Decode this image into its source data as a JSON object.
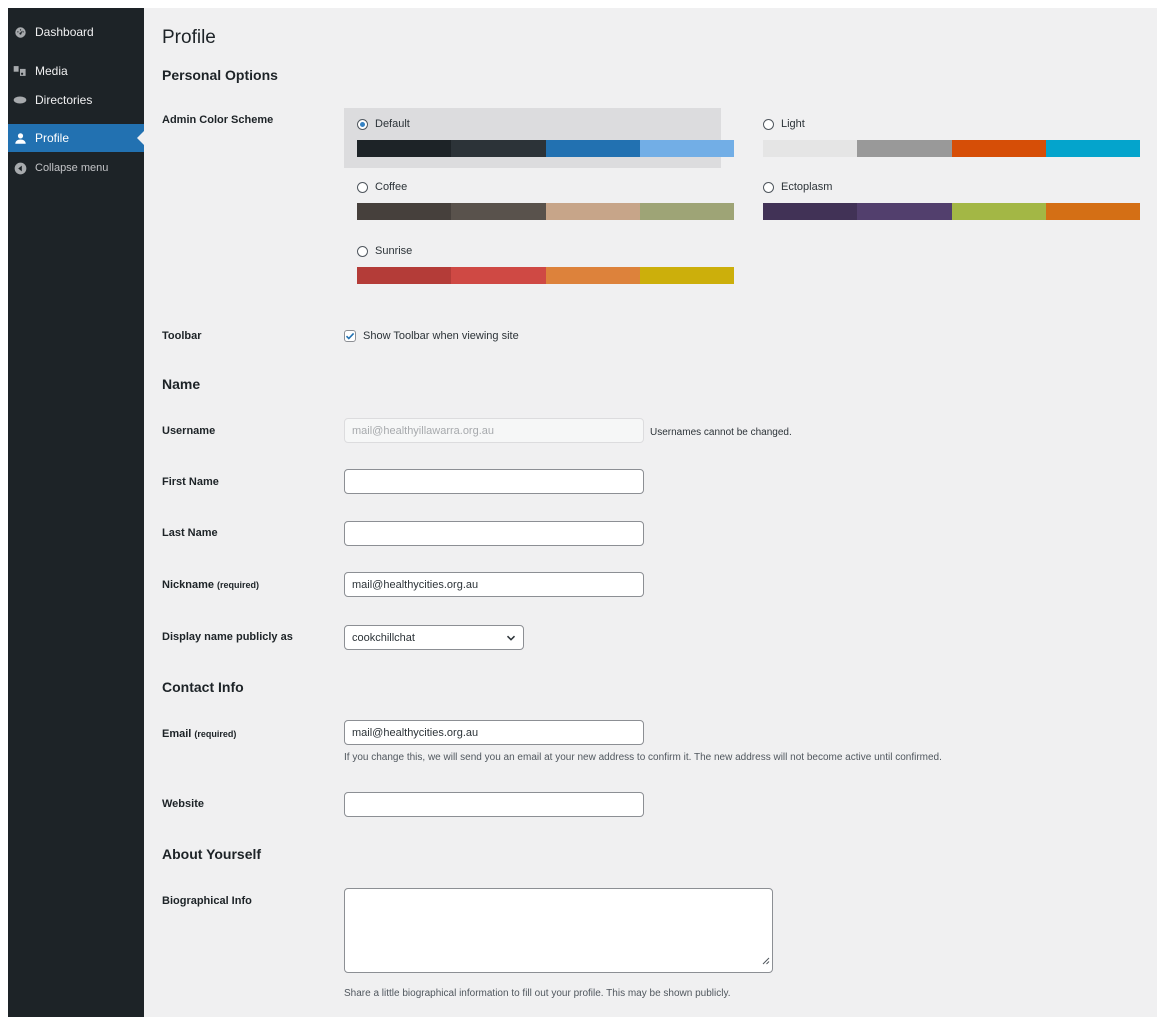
{
  "sidebar": {
    "items": [
      {
        "label": "Dashboard",
        "icon": "dashboard-icon"
      },
      {
        "label": "Media",
        "icon": "media-icon"
      },
      {
        "label": "Directories",
        "icon": "directories-icon"
      },
      {
        "label": "Profile",
        "icon": "user-icon",
        "active": true
      },
      {
        "label": "Collapse menu",
        "icon": "collapse-icon"
      }
    ]
  },
  "page": {
    "title": "Profile"
  },
  "personal_options": {
    "heading": "Personal Options",
    "color_scheme_label": "Admin Color Scheme",
    "schemes": [
      {
        "name": "Default",
        "selected": true,
        "colors": [
          "#1d2327",
          "#2c3338",
          "#2271b1",
          "#72aee6"
        ]
      },
      {
        "name": "Light",
        "selected": false,
        "colors": [
          "#e5e5e5",
          "#999999",
          "#d64e07",
          "#04a4cc"
        ]
      },
      {
        "name": "Coffee",
        "selected": false,
        "colors": [
          "#46403c",
          "#59524c",
          "#c7a589",
          "#9ea476"
        ]
      },
      {
        "name": "Ectoplasm",
        "selected": false,
        "colors": [
          "#413256",
          "#523f6d",
          "#a3b745",
          "#d46f15"
        ]
      },
      {
        "name": "Sunrise",
        "selected": false,
        "colors": [
          "#b43c38",
          "#cf4944",
          "#dd823b",
          "#ccaf0b"
        ]
      }
    ],
    "toolbar_label": "Toolbar",
    "toolbar_option": "Show Toolbar when viewing site",
    "toolbar_checked": true
  },
  "name_section": {
    "heading": "Name",
    "username_label": "Username",
    "username_value": "mail@healthyillawarra.org.au",
    "username_note": "Usernames cannot be changed.",
    "first_name_label": "First Name",
    "first_name_value": "",
    "last_name_label": "Last Name",
    "last_name_value": "",
    "nickname_label": "Nickname",
    "nickname_required": "(required)",
    "nickname_value": "mail@healthycities.org.au",
    "display_label": "Display name publicly as",
    "display_value": "cookchillchat"
  },
  "contact": {
    "heading": "Contact Info",
    "email_label": "Email",
    "email_required": "(required)",
    "email_value": "mail@healthycities.org.au",
    "email_note": "If you change this, we will send you an email at your new address to confirm it. The new address will not become active until confirmed.",
    "website_label": "Website",
    "website_value": ""
  },
  "about": {
    "heading": "About Yourself",
    "bio_label": "Biographical Info",
    "bio_note": "Share a little biographical information to fill out your profile. This may be shown publicly."
  },
  "colors": {
    "accent": "#2271b1",
    "sidebar": "#1d2327",
    "background": "#f0f0f1"
  }
}
